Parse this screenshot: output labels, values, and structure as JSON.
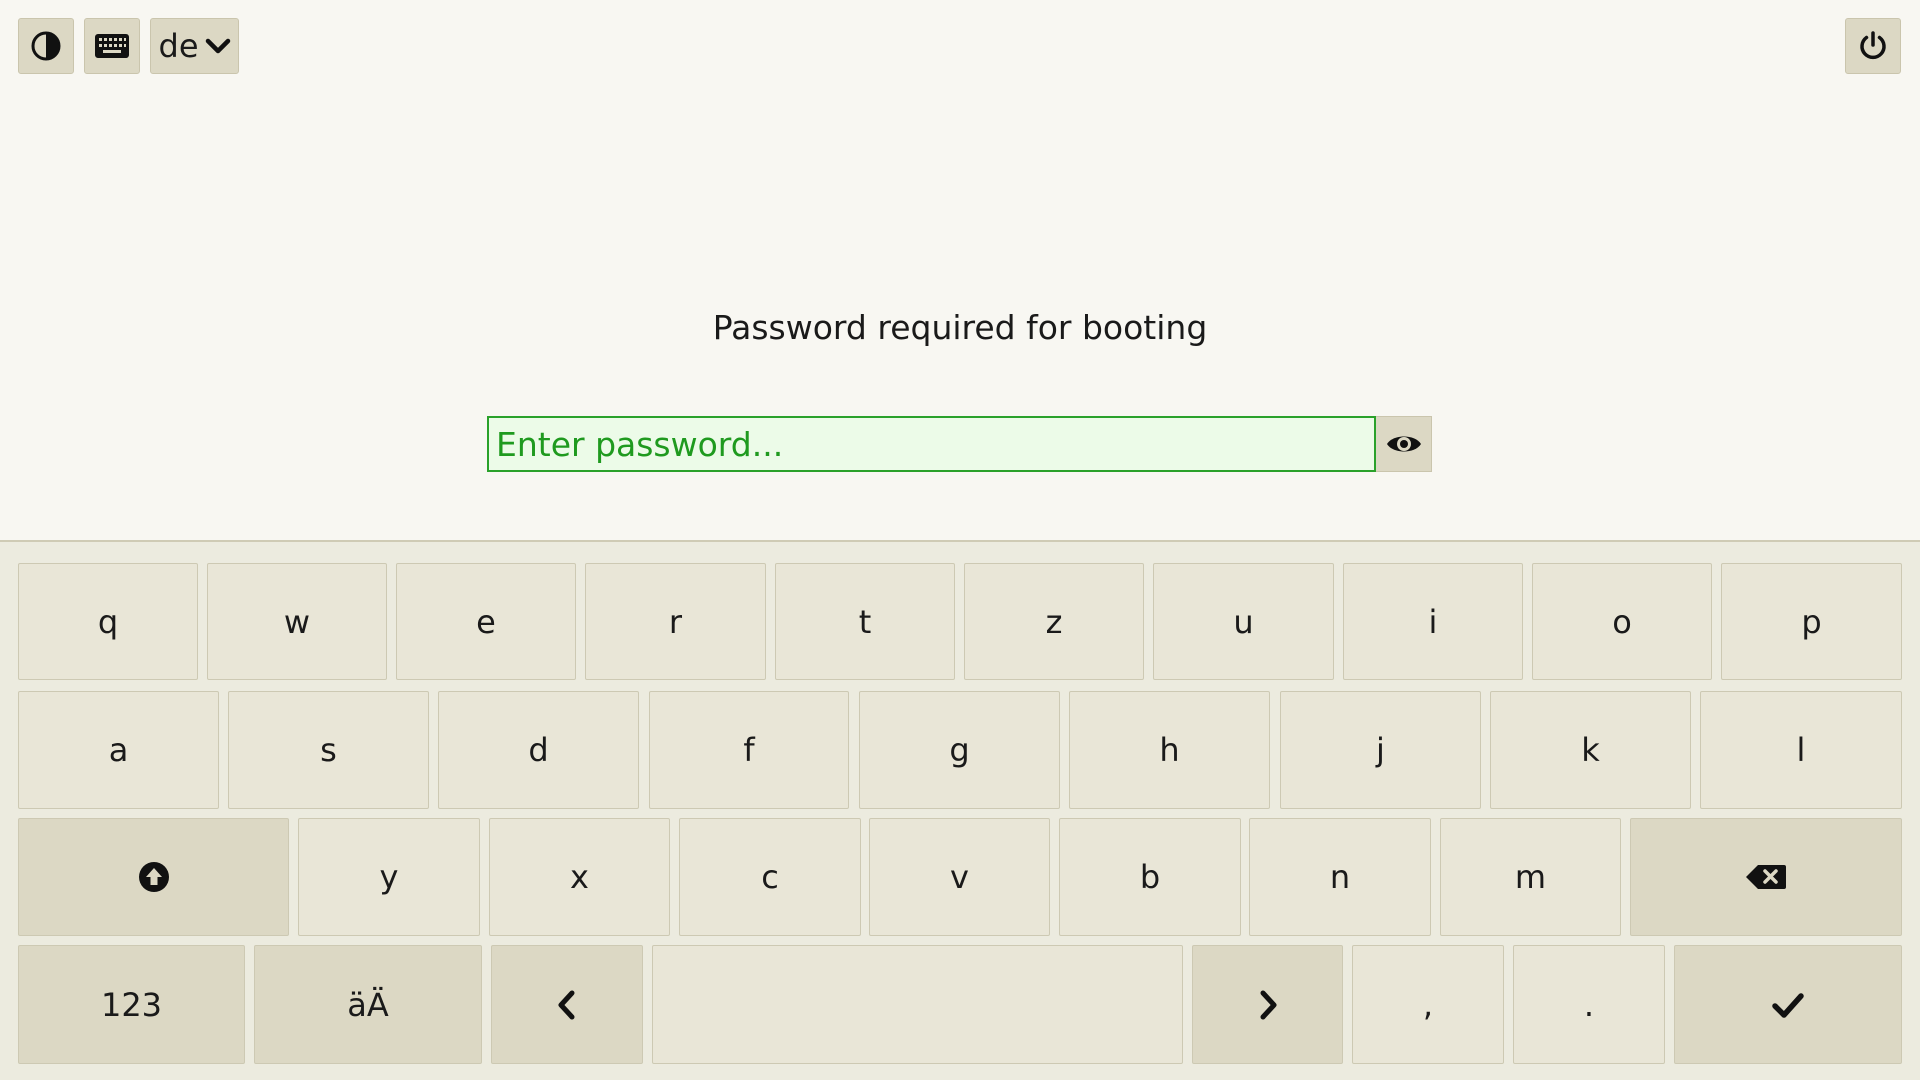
{
  "toolbar": {
    "contrast_icon": "contrast-icon",
    "keyboard_icon": "keyboard-icon",
    "language": "de",
    "language_icon": "chevron-down-icon",
    "power_icon": "power-icon"
  },
  "prompt": {
    "text": "Password required for booting"
  },
  "password": {
    "placeholder": "Enter password...",
    "value": "",
    "reveal_icon": "eye-icon"
  },
  "keyboard": {
    "row1": [
      "q",
      "w",
      "e",
      "r",
      "t",
      "z",
      "u",
      "i",
      "o",
      "p"
    ],
    "row2": [
      "a",
      "s",
      "d",
      "f",
      "g",
      "h",
      "j",
      "k",
      "l"
    ],
    "row3": [
      "y",
      "x",
      "c",
      "v",
      "b",
      "n",
      "m"
    ],
    "shift_icon": "shift-icon",
    "backspace_icon": "backspace-icon",
    "numbers_label": "123",
    "umlauts_label": "äÄ",
    "left_icon": "chevron-left-icon",
    "space_label": "",
    "right_icon": "chevron-right-icon",
    "comma_label": ",",
    "period_label": ".",
    "enter_icon": "check-icon"
  },
  "colors": {
    "background": "#f8f7f2",
    "key": "#e9e6d7",
    "function_key": "#dcd8c4",
    "input_text": "#1f9a1f",
    "input_border": "#2aa12a",
    "input_background": "#ecfbe8"
  }
}
